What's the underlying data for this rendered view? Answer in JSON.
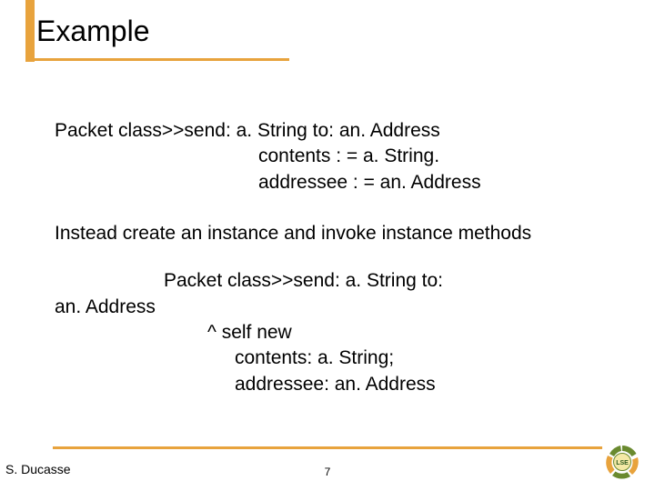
{
  "title": "Example",
  "code1": {
    "l1": "Packet class>>send: a. String to: an. Address",
    "l2": "contents : = a. String.",
    "l3": "addressee : = an. Address"
  },
  "para": "Instead create an instance and invoke instance methods",
  "code2": {
    "l1a": "Packet class>>send: a. String to:",
    "l1b": "an. Address",
    "l2": "^ self new",
    "l3": "contents: a. String;",
    "l4": "addressee: an. Address"
  },
  "footer": {
    "author": "S. Ducasse",
    "page": "7"
  }
}
